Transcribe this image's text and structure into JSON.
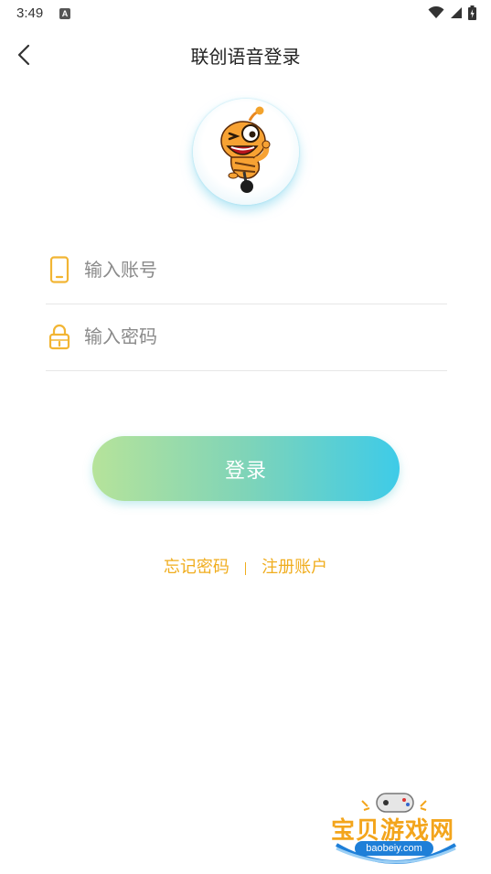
{
  "status_bar": {
    "time": "3:49",
    "notif_letter": "A"
  },
  "nav": {
    "title": "联创语音登录"
  },
  "form": {
    "account_placeholder": "输入账号",
    "password_placeholder": "输入密码",
    "login_label": "登录"
  },
  "links": {
    "forgot": "忘记密码",
    "register": "注册账户"
  },
  "watermark": {
    "name": "宝贝游戏网",
    "url": "baobeiy.com"
  },
  "colors": {
    "accent_orange": "#f0ad1e",
    "gradient_start": "#b6e39a",
    "gradient_end": "#3ecbe8"
  }
}
